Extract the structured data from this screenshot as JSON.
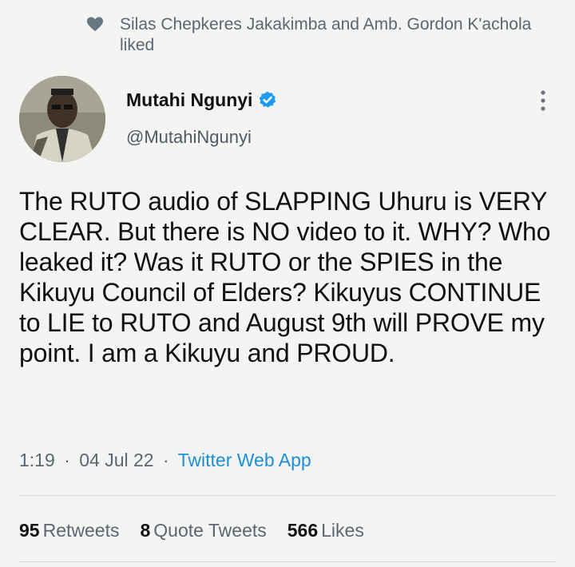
{
  "social_context": {
    "icon": "heart-icon",
    "text": "Silas Chepkeres Jakakimba and Amb. Gordon K'achola liked"
  },
  "author": {
    "name": "Mutahi Ngunyi",
    "handle": "@MutahiNgunyi",
    "verified_icon": "verified-badge-icon",
    "avatar_icon": "profile-avatar"
  },
  "tweet": {
    "text": "The RUTO audio of SLAPPING Uhuru is VERY CLEAR. But there is NO video to it. WHY? Who leaked it? Was it RUTO or the SPIES in the Kikuyu Council of Elders? Kikuyus CONTINUE to LIE to RUTO and August 9th will PROVE my point. I am a Kikuyu and PROUD.",
    "time": "1:19",
    "date": "04 Jul 22",
    "separator": "·",
    "source": "Twitter Web App"
  },
  "stats": {
    "retweets_count": "95",
    "retweets_label": "Retweets",
    "quote_count": "8",
    "quote_label": "Quote Tweets",
    "likes_count": "566",
    "likes_label": "Likes"
  },
  "colors": {
    "accent": "#1d9bf0",
    "muted_text": "#5b6670",
    "background": "#f4f4f2"
  }
}
